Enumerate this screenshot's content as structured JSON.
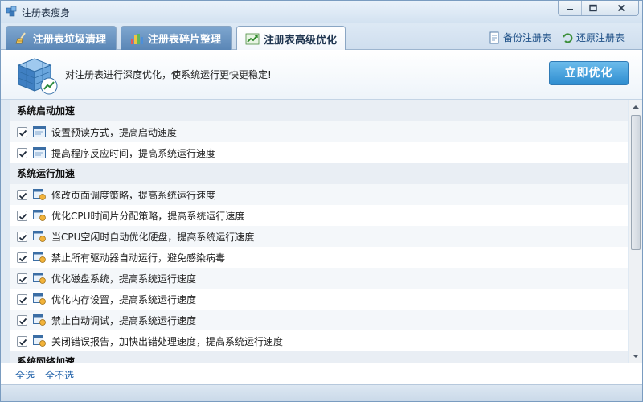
{
  "window": {
    "title": "注册表瘦身"
  },
  "tabs": [
    {
      "label": "注册表垃圾清理",
      "icon": "broom-icon",
      "active": false
    },
    {
      "label": "注册表碎片整理",
      "icon": "defrag-chart-icon",
      "active": false
    },
    {
      "label": "注册表高级优化",
      "icon": "trend-chart-icon",
      "active": true
    }
  ],
  "toolbar": {
    "backup_label": "备份注册表",
    "restore_label": "还原注册表"
  },
  "banner": {
    "message": "对注册表进行深度优化，使系统运行更快更稳定!",
    "optimize_label": "立即优化"
  },
  "groups": [
    {
      "title": "系统启动加速",
      "items": [
        {
          "label": "设置预读方式，提高启动速度",
          "checked": true,
          "icon": "window-icon"
        },
        {
          "label": "提高程序反应时间，提高系统运行速度",
          "checked": true,
          "icon": "window-icon"
        }
      ]
    },
    {
      "title": "系统运行加速",
      "items": [
        {
          "label": "修改页面调度策略，提高系统运行速度",
          "checked": true,
          "icon": "settings-window-icon"
        },
        {
          "label": "优化CPU时间片分配策略，提高系统运行速度",
          "checked": true,
          "icon": "settings-window-icon"
        },
        {
          "label": "当CPU空闲时自动优化硬盘，提高系统运行速度",
          "checked": true,
          "icon": "settings-window-icon"
        },
        {
          "label": "禁止所有驱动器自动运行，避免感染病毒",
          "checked": true,
          "icon": "settings-window-icon"
        },
        {
          "label": "优化磁盘系统，提高系统运行速度",
          "checked": true,
          "icon": "settings-window-icon"
        },
        {
          "label": "优化内存设置，提高系统运行速度",
          "checked": true,
          "icon": "settings-window-icon"
        },
        {
          "label": "禁止自动调试，提高系统运行速度",
          "checked": true,
          "icon": "settings-window-icon"
        },
        {
          "label": "关闭错误报告，加快出错处理速度，提高系统运行速度",
          "checked": true,
          "icon": "settings-window-icon"
        }
      ]
    },
    {
      "title": "系统网络加速",
      "items": []
    }
  ],
  "footer": {
    "select_all": "全选",
    "select_none": "全不选"
  },
  "colors": {
    "accent": "#2e8dd0",
    "tab_inactive": "#5a86b6",
    "link": "#1d5fa8"
  }
}
